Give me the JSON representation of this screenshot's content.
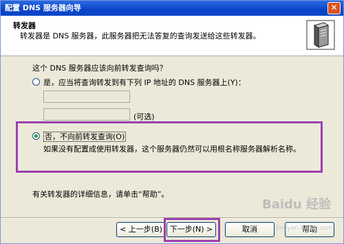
{
  "window": {
    "title": "配置 DNS 服务器向导",
    "close_label": "✕"
  },
  "header": {
    "title": "转发器",
    "subtitle": "转发器是 DNS 服务器，此服务器把无法答复的查询发送给这些转发器。"
  },
  "body": {
    "question": "这个 DNS 服务器应该向前转发查询吗？",
    "option_yes": "是，应当将查询转发到有下列 IP 地址的 DNS 服务器上(Y)：",
    "ip_field_1": "",
    "ip_field_2": "",
    "optional_label": "(可选)",
    "option_no": "否，不向前转发查询(O)",
    "option_no_selected": true,
    "option_no_description": "如果没有配置成使用转发器，这个服务器仍然可以用根名称服务器解析名称。",
    "more_info": "有关转发器的详细信息，请单击“帮助”。"
  },
  "buttons": {
    "back": "< 上一步(B)",
    "next": "下一步(N) >",
    "cancel": "取消",
    "help": "帮助"
  },
  "watermark": {
    "main": "Baidu 经验",
    "sub": "jingyan.baidu.com"
  },
  "colors": {
    "highlight": "#9b3fb0",
    "titlebar": "#0a44c8",
    "radio_dot": "#21a121"
  },
  "icons": {
    "wizard": "server-icon"
  }
}
